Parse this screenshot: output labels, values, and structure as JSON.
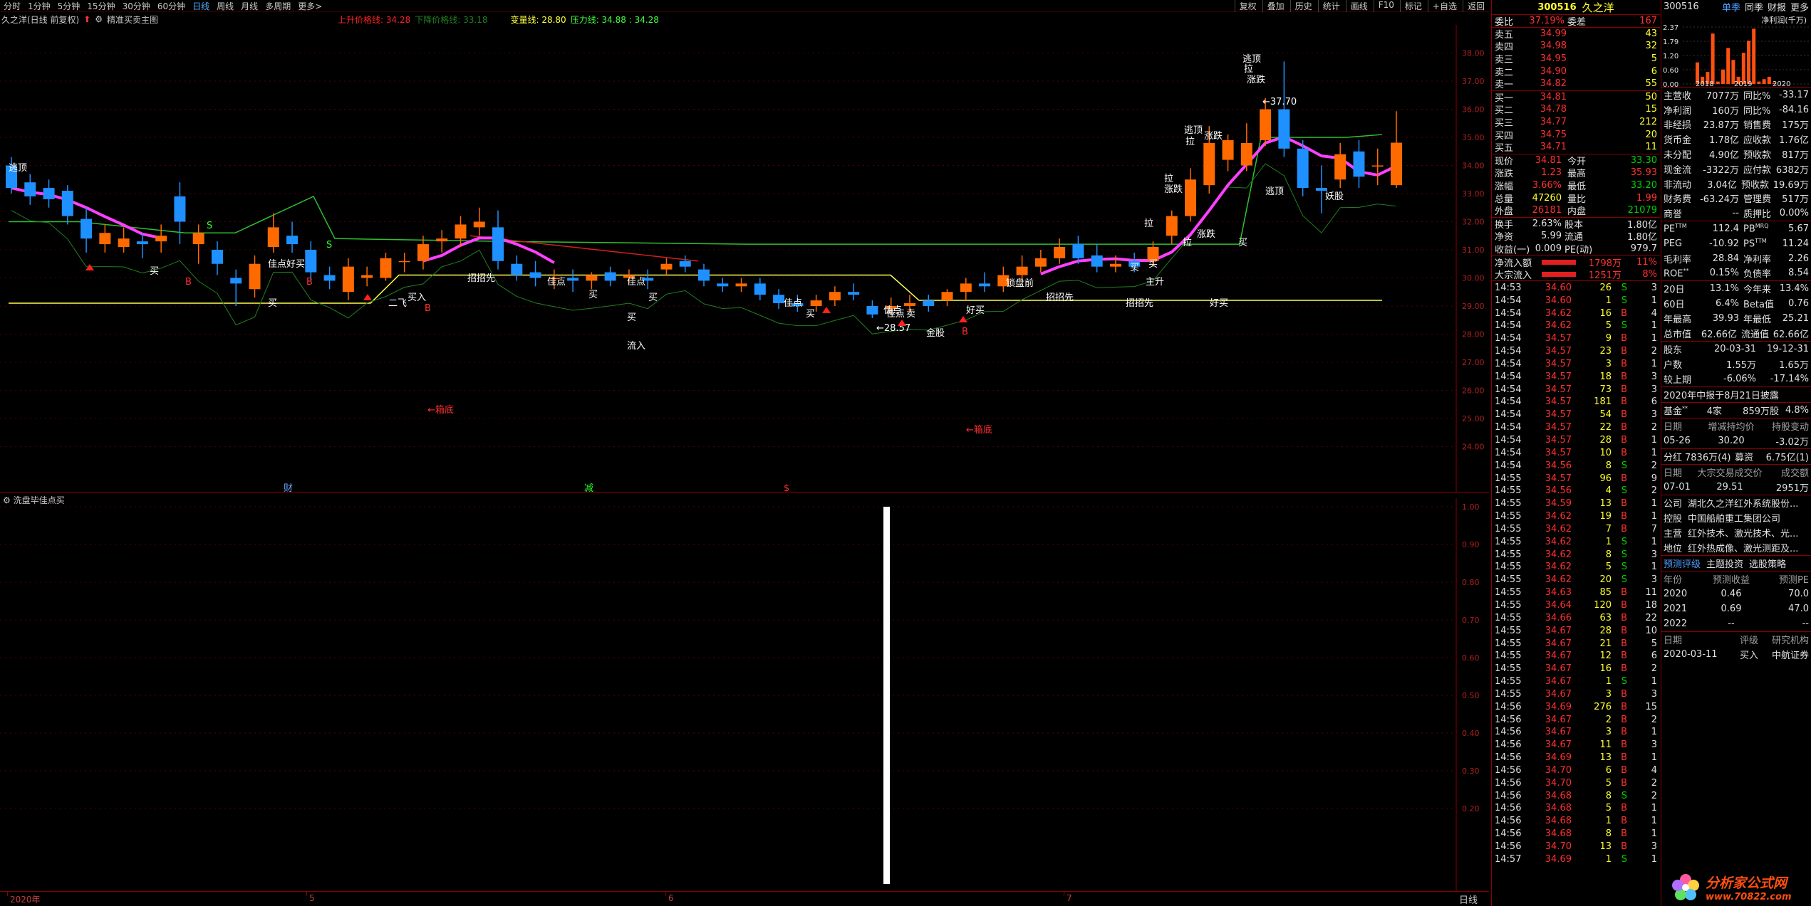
{
  "toolbar": {
    "periods": [
      "分时",
      "1分钟",
      "5分钟",
      "15分钟",
      "30分钟",
      "60分钟",
      "日线",
      "周线",
      "月线",
      "多周期",
      "更多>"
    ],
    "active_period": "日线",
    "right_buttons": [
      "复权",
      "叠加",
      "历史",
      "统计",
      "画线",
      "F10",
      "标记",
      "+自选",
      "返回"
    ]
  },
  "chart_info": {
    "stock_title": "久之洋(日线 前复权)",
    "formula_name": "精准买卖主图",
    "up_line_label": "上升价格线: 34.28",
    "down_line_label": "下降价格线: 33.18",
    "change_line_label": "变量线: 28.80",
    "pressure_line_label": "压力线: 34.88 : 34.28"
  },
  "price_axis": [
    "38.00",
    "37.00",
    "36.00",
    "35.00",
    "34.00",
    "33.00",
    "32.00",
    "31.00",
    "30.00",
    "29.00",
    "28.00",
    "27.00",
    "26.00",
    "25.00",
    "24.00"
  ],
  "sub_axis": [
    "1.00",
    "0.90",
    "0.80",
    "0.70",
    "0.60",
    "0.50",
    "0.40",
    "0.30",
    "0.20"
  ],
  "sub_panel": {
    "title": "洗盘毕佳点买"
  },
  "date_axis": {
    "labels": [
      "2020年",
      "5",
      "6",
      "7"
    ],
    "period": "日线"
  },
  "annotations": {
    "chart_texts": [
      "逃顶",
      "买",
      "B",
      "S",
      "佳点",
      "好买",
      "买",
      "B",
      "S",
      "二飞",
      "买入",
      "B",
      "招招先",
      "佳点",
      "买",
      "买",
      "流入",
      "佳点",
      "买",
      "佳点",
      "买",
      "佳点",
      "卖",
      "金股",
      "B",
      "←28.57",
      "佳点",
      "←箱底",
      "←箱底",
      "财",
      "减",
      "$",
      "锁盘前",
      "招招先",
      "好买",
      "招招先",
      "拉",
      "涨跌",
      "拉",
      "涨跌",
      "逃顶",
      "拉",
      "涨跌",
      "逃顶",
      "拉",
      "涨跌",
      "←37.70",
      "逃顶",
      "妖股",
      "买",
      "买",
      "拉",
      "主升",
      "好买",
      "买"
    ],
    "peak_label": "←37.70",
    "low_label": "←28.57"
  },
  "quote": {
    "code": "300516",
    "name": "久之洋",
    "weibi_label": "委比",
    "weibi_value": "37.19%",
    "weicha_label": "委差",
    "weicha_value": "167",
    "asks": [
      {
        "label": "卖五",
        "price": "34.99",
        "vol": "43"
      },
      {
        "label": "卖四",
        "price": "34.98",
        "vol": "32"
      },
      {
        "label": "卖三",
        "price": "34.95",
        "vol": "5"
      },
      {
        "label": "卖二",
        "price": "34.90",
        "vol": "6"
      },
      {
        "label": "卖一",
        "price": "34.82",
        "vol": "55"
      }
    ],
    "bids": [
      {
        "label": "买一",
        "price": "34.81",
        "vol": "50"
      },
      {
        "label": "买二",
        "price": "34.78",
        "vol": "15"
      },
      {
        "label": "买三",
        "price": "34.77",
        "vol": "212"
      },
      {
        "label": "买四",
        "price": "34.75",
        "vol": "20"
      },
      {
        "label": "买五",
        "price": "34.71",
        "vol": "11"
      }
    ],
    "stats": [
      {
        "l1": "现价",
        "v1": "34.81",
        "c1": "red",
        "l2": "今开",
        "v2": "33.30",
        "c2": "green"
      },
      {
        "l1": "涨跌",
        "v1": "1.23",
        "c1": "red",
        "l2": "最高",
        "v2": "35.93",
        "c2": "red"
      },
      {
        "l1": "涨幅",
        "v1": "3.66%",
        "c1": "red",
        "l2": "最低",
        "v2": "33.20",
        "c2": "green"
      },
      {
        "l1": "总量",
        "v1": "47260",
        "c1": "yellow",
        "l2": "量比",
        "v2": "1.99",
        "c2": "red"
      },
      {
        "l1": "外盘",
        "v1": "26181",
        "c1": "red",
        "l2": "内盘",
        "v2": "21079",
        "c2": "green"
      }
    ],
    "stats2": [
      {
        "l1": "换手",
        "v1": "2.63%",
        "l2": "股本",
        "v2": "1.80亿"
      },
      {
        "l1": "净资",
        "v1": "5.99",
        "l2": "流通",
        "v2": "1.80亿"
      },
      {
        "l1": "收益(一)",
        "v1": "0.009",
        "l2": "PE(动)",
        "v2": "979.7"
      }
    ],
    "flows": [
      {
        "label": "净流入额",
        "value": "1798万",
        "pct": "11%"
      },
      {
        "label": "大宗流入",
        "value": "1251万",
        "pct": "8%"
      }
    ],
    "ticks": [
      {
        "t": "14:53",
        "p": "34.60",
        "v": "26",
        "d": "S",
        "n": "3"
      },
      {
        "t": "14:54",
        "p": "34.60",
        "v": "1",
        "d": "S",
        "n": "1"
      },
      {
        "t": "14:54",
        "p": "34.62",
        "v": "16",
        "d": "B",
        "n": "4"
      },
      {
        "t": "14:54",
        "p": "34.62",
        "v": "5",
        "d": "S",
        "n": "1"
      },
      {
        "t": "14:54",
        "p": "34.57",
        "v": "9",
        "d": "B",
        "n": "1"
      },
      {
        "t": "14:54",
        "p": "34.57",
        "v": "23",
        "d": "B",
        "n": "2"
      },
      {
        "t": "14:54",
        "p": "34.57",
        "v": "3",
        "d": "B",
        "n": "1"
      },
      {
        "t": "14:54",
        "p": "34.57",
        "v": "18",
        "d": "B",
        "n": "3"
      },
      {
        "t": "14:54",
        "p": "34.57",
        "v": "73",
        "d": "B",
        "n": "3"
      },
      {
        "t": "14:54",
        "p": "34.57",
        "v": "181",
        "d": "B",
        "n": "6"
      },
      {
        "t": "14:54",
        "p": "34.57",
        "v": "54",
        "d": "B",
        "n": "3"
      },
      {
        "t": "14:54",
        "p": "34.57",
        "v": "22",
        "d": "B",
        "n": "2"
      },
      {
        "t": "14:54",
        "p": "34.57",
        "v": "28",
        "d": "B",
        "n": "1"
      },
      {
        "t": "14:54",
        "p": "34.57",
        "v": "10",
        "d": "B",
        "n": "1"
      },
      {
        "t": "14:54",
        "p": "34.56",
        "v": "8",
        "d": "S",
        "n": "2"
      },
      {
        "t": "14:55",
        "p": "34.57",
        "v": "96",
        "d": "B",
        "n": "9"
      },
      {
        "t": "14:55",
        "p": "34.56",
        "v": "4",
        "d": "S",
        "n": "2"
      },
      {
        "t": "14:55",
        "p": "34.59",
        "v": "13",
        "d": "B",
        "n": "1"
      },
      {
        "t": "14:55",
        "p": "34.62",
        "v": "19",
        "d": "B",
        "n": "1"
      },
      {
        "t": "14:55",
        "p": "34.62",
        "v": "7",
        "d": "B",
        "n": "7"
      },
      {
        "t": "14:55",
        "p": "34.62",
        "v": "1",
        "d": "S",
        "n": "1"
      },
      {
        "t": "14:55",
        "p": "34.62",
        "v": "8",
        "d": "S",
        "n": "3"
      },
      {
        "t": "14:55",
        "p": "34.62",
        "v": "5",
        "d": "S",
        "n": "1"
      },
      {
        "t": "14:55",
        "p": "34.62",
        "v": "20",
        "d": "S",
        "n": "3"
      },
      {
        "t": "14:55",
        "p": "34.63",
        "v": "85",
        "d": "B",
        "n": "11"
      },
      {
        "t": "14:55",
        "p": "34.64",
        "v": "120",
        "d": "B",
        "n": "18"
      },
      {
        "t": "14:55",
        "p": "34.66",
        "v": "63",
        "d": "B",
        "n": "22"
      },
      {
        "t": "14:55",
        "p": "34.67",
        "v": "28",
        "d": "B",
        "n": "10"
      },
      {
        "t": "14:55",
        "p": "34.67",
        "v": "21",
        "d": "B",
        "n": "5"
      },
      {
        "t": "14:55",
        "p": "34.67",
        "v": "12",
        "d": "B",
        "n": "6"
      },
      {
        "t": "14:55",
        "p": "34.67",
        "v": "16",
        "d": "B",
        "n": "2"
      },
      {
        "t": "14:55",
        "p": "34.67",
        "v": "1",
        "d": "S",
        "n": "1"
      },
      {
        "t": "14:55",
        "p": "34.67",
        "v": "3",
        "d": "B",
        "n": "3"
      },
      {
        "t": "14:56",
        "p": "34.69",
        "v": "276",
        "d": "B",
        "n": "15"
      },
      {
        "t": "14:56",
        "p": "34.67",
        "v": "2",
        "d": "B",
        "n": "2"
      },
      {
        "t": "14:56",
        "p": "34.67",
        "v": "3",
        "d": "B",
        "n": "1"
      },
      {
        "t": "14:56",
        "p": "34.67",
        "v": "11",
        "d": "B",
        "n": "3"
      },
      {
        "t": "14:56",
        "p": "34.69",
        "v": "13",
        "d": "B",
        "n": "1"
      },
      {
        "t": "14:56",
        "p": "34.70",
        "v": "6",
        "d": "B",
        "n": "4"
      },
      {
        "t": "14:56",
        "p": "34.70",
        "v": "5",
        "d": "B",
        "n": "2"
      },
      {
        "t": "14:56",
        "p": "34.68",
        "v": "8",
        "d": "S",
        "n": "2"
      },
      {
        "t": "14:56",
        "p": "34.68",
        "v": "5",
        "d": "B",
        "n": "1"
      },
      {
        "t": "14:56",
        "p": "34.68",
        "v": "1",
        "d": "B",
        "n": "1"
      },
      {
        "t": "14:56",
        "p": "34.68",
        "v": "8",
        "d": "B",
        "n": "1"
      },
      {
        "t": "14:56",
        "p": "34.70",
        "v": "13",
        "d": "B",
        "n": "3"
      },
      {
        "t": "14:57",
        "p": "34.69",
        "v": "1",
        "d": "S",
        "n": "1"
      }
    ]
  },
  "f10": {
    "code": "300516",
    "tabs": [
      "单季",
      "同季",
      "财报",
      "更多"
    ],
    "chart_title": "净利润(千万)",
    "chart_years": [
      "2018",
      "2019",
      "2020"
    ],
    "chart_yticks": [
      "2.37",
      "1.79",
      "1.20",
      "0.60",
      "0.00"
    ],
    "chart_bars": [
      0.9,
      0.3,
      0.5,
      2.1,
      0.1,
      0.6,
      1.5,
      1.0,
      0.3,
      1.3,
      1.8,
      2.3,
      0.1,
      0.2,
      0.3,
      0.05
    ],
    "finance": [
      {
        "l1": "主营收",
        "v1": "7077万",
        "l2": "同比%",
        "v2": "-33.17"
      },
      {
        "l1": "净利润",
        "v1": "160万",
        "l2": "同比%",
        "v2": "-84.16"
      },
      {
        "l1": "非经损",
        "v1": "23.87万",
        "l2": "销售费",
        "v2": "175万"
      },
      {
        "l1": "货币金",
        "v1": "1.78亿",
        "l2": "应收款",
        "v2": "1.76亿"
      },
      {
        "l1": "未分配",
        "v1": "4.90亿",
        "l2": "预收款",
        "v2": "817万"
      },
      {
        "l1": "现金流",
        "v1": "-3322万",
        "l2": "应付款",
        "v2": "6382万"
      },
      {
        "l1": "非流动",
        "v1": "3.04亿",
        "l2": "预收款",
        "v2": "19.69万"
      },
      {
        "l1": "财务费",
        "v1": "-63.24万",
        "l2": "管理费",
        "v2": "517万"
      },
      {
        "l1": "商誉",
        "v1": "--",
        "l2": "质押比",
        "v2": "0.00%"
      }
    ],
    "valuation": [
      {
        "l1": "PE",
        "s1": "TTM",
        "v1": "112.4",
        "l2": "PB",
        "s2": "MRQ",
        "v2": "5.67"
      },
      {
        "l1": "PEG",
        "s1": "",
        "v1": "-10.92",
        "l2": "PS",
        "s2": "TTM",
        "v2": "11.24"
      },
      {
        "l1": "毛利率",
        "s1": "",
        "v1": "28.84",
        "l2": "净利率",
        "s2": "",
        "v2": "2.26"
      },
      {
        "l1": "ROE",
        "s1": "**",
        "v1": "0.15%",
        "l2": "负债率",
        "s2": "",
        "v2": "8.54"
      }
    ],
    "perf": [
      {
        "l1": "20日",
        "v1": "13.1%",
        "l2": "今年来",
        "v2": "13.4%"
      },
      {
        "l1": "60日",
        "v1": "6.4%",
        "l2": "Beta值",
        "v2": "0.76"
      },
      {
        "l1": "年最高",
        "v1": "39.93",
        "l2": "年最低",
        "v2": "25.21"
      },
      {
        "l1": "总市值",
        "v1": "62.66亿",
        "l2": "流通值",
        "v2": "62.66亿"
      }
    ],
    "holders": [
      {
        "l1": "股东",
        "v1": "20-03-31",
        "v2": "19-12-31"
      },
      {
        "l1": "户数",
        "v1": "1.55万",
        "v2": "1.65万"
      },
      {
        "l1": "较上期",
        "v1": "-6.06%",
        "v2": "-17.14%"
      }
    ],
    "report_notice": "2020年中报于8月21日披露",
    "fund": {
      "l1": "基金",
      "s1": "**",
      "v1": "4家",
      "v2": "859万股",
      "v3": "4.8%"
    },
    "change_head": [
      "日期",
      "增减持均价",
      "持股变动"
    ],
    "change_row": [
      "05-26",
      "30.20",
      "-3.02万"
    ],
    "dividend": {
      "l1": "分红",
      "v1": "7836万(4)",
      "l2": "募资",
      "v2": "6.75亿(1)"
    },
    "block_head": [
      "日期",
      "大宗交易成交价",
      "成交额"
    ],
    "block_row": [
      "07-01",
      "29.51",
      "2951万"
    ],
    "company": [
      {
        "l": "公司",
        "v": "湖北久之洋红外系统股份..."
      },
      {
        "l": "控股",
        "v": "中国船舶重工集团公司"
      },
      {
        "l": "主营",
        "v": "红外技术、激光技术、光..."
      },
      {
        "l": "地位",
        "v": "红外热成像、激光测距及..."
      }
    ],
    "links": [
      "预测评级",
      "主题投资",
      "选股策略"
    ],
    "forecast_head": [
      "年份",
      "预测收益",
      "预测PE"
    ],
    "forecast": [
      [
        "2020",
        "0.46",
        "70.0"
      ],
      [
        "2021",
        "0.69",
        "47.0"
      ],
      [
        "2022",
        "--",
        "--"
      ]
    ],
    "rating_head": [
      "日期",
      "评级",
      "研究机构"
    ],
    "rating": [
      [
        "2020-03-11",
        "买入",
        "中航证券"
      ]
    ],
    "watermark_cn": "分析家公式网",
    "watermark_url": "www.70822.com"
  },
  "colors": {
    "up": "#ff6a00",
    "down": "#1e90ff",
    "ma_pink": "#ff40ff",
    "line_yellow": "#ffff50",
    "line_green": "#30c030",
    "line_red": "#d02020",
    "grid": "#550000"
  },
  "candles": [
    {
      "o": 34.0,
      "c": 33.2,
      "h": 34.3,
      "l": 33.0
    },
    {
      "o": 33.4,
      "c": 32.9,
      "h": 33.7,
      "l": 32.6
    },
    {
      "o": 33.2,
      "c": 32.8,
      "h": 33.5,
      "l": 32.5
    },
    {
      "o": 33.1,
      "c": 32.2,
      "h": 33.3,
      "l": 31.9
    },
    {
      "o": 32.1,
      "c": 31.4,
      "h": 32.5,
      "l": 30.9
    },
    {
      "o": 31.2,
      "c": 31.6,
      "h": 31.9,
      "l": 30.9
    },
    {
      "o": 31.1,
      "c": 31.4,
      "h": 31.8,
      "l": 30.9
    },
    {
      "o": 31.3,
      "c": 31.2,
      "h": 31.6,
      "l": 30.7
    },
    {
      "o": 31.3,
      "c": 31.5,
      "h": 31.9,
      "l": 30.9
    },
    {
      "o": 32.9,
      "c": 32.0,
      "h": 33.4,
      "l": 31.2
    },
    {
      "o": 31.2,
      "c": 31.6,
      "h": 31.9,
      "l": 30.5
    },
    {
      "o": 31.0,
      "c": 30.5,
      "h": 31.3,
      "l": 30.1
    },
    {
      "o": 30.0,
      "c": 29.8,
      "h": 30.3,
      "l": 29.0
    },
    {
      "o": 29.6,
      "c": 30.5,
      "h": 30.8,
      "l": 29.3
    },
    {
      "o": 31.1,
      "c": 31.8,
      "h": 32.3,
      "l": 30.9
    },
    {
      "o": 31.5,
      "c": 31.2,
      "h": 32.0,
      "l": 30.9
    },
    {
      "o": 31.0,
      "c": 30.2,
      "h": 31.3,
      "l": 29.9
    },
    {
      "o": 30.1,
      "c": 29.9,
      "h": 30.4,
      "l": 29.6
    },
    {
      "o": 29.5,
      "c": 30.4,
      "h": 30.7,
      "l": 29.2
    },
    {
      "o": 30.0,
      "c": 30.1,
      "h": 30.4,
      "l": 29.7
    },
    {
      "o": 30.0,
      "c": 30.7,
      "h": 30.9,
      "l": 29.9
    },
    {
      "o": 30.6,
      "c": 30.6,
      "h": 30.9,
      "l": 30.2
    },
    {
      "o": 30.6,
      "c": 31.2,
      "h": 31.5,
      "l": 30.3
    },
    {
      "o": 31.3,
      "c": 31.4,
      "h": 31.7,
      "l": 30.9
    },
    {
      "o": 31.4,
      "c": 31.9,
      "h": 32.2,
      "l": 31.1
    },
    {
      "o": 31.8,
      "c": 32.0,
      "h": 32.5,
      "l": 31.5
    },
    {
      "o": 31.8,
      "c": 30.6,
      "h": 32.4,
      "l": 30.3
    },
    {
      "o": 30.5,
      "c": 30.1,
      "h": 30.8,
      "l": 29.9
    },
    {
      "o": 30.2,
      "c": 30.0,
      "h": 30.6,
      "l": 29.7
    },
    {
      "o": 30.0,
      "c": 30.0,
      "h": 30.3,
      "l": 29.6
    },
    {
      "o": 30.0,
      "c": 29.9,
      "h": 30.3,
      "l": 29.5
    },
    {
      "o": 29.9,
      "c": 30.1,
      "h": 30.2,
      "l": 29.6
    },
    {
      "o": 30.2,
      "c": 29.9,
      "h": 30.4,
      "l": 29.7
    },
    {
      "o": 30.0,
      "c": 30.1,
      "h": 30.3,
      "l": 29.8
    },
    {
      "o": 30.0,
      "c": 29.9,
      "h": 30.3,
      "l": 29.6
    },
    {
      "o": 30.3,
      "c": 30.5,
      "h": 30.7,
      "l": 30.1
    },
    {
      "o": 30.6,
      "c": 30.4,
      "h": 30.8,
      "l": 30.2
    },
    {
      "o": 30.3,
      "c": 29.9,
      "h": 30.5,
      "l": 29.7
    },
    {
      "o": 29.8,
      "c": 29.7,
      "h": 30.0,
      "l": 29.5
    },
    {
      "o": 29.7,
      "c": 29.8,
      "h": 30.0,
      "l": 29.5
    },
    {
      "o": 29.8,
      "c": 29.4,
      "h": 30.0,
      "l": 29.2
    },
    {
      "o": 29.4,
      "c": 29.1,
      "h": 29.6,
      "l": 28.9
    },
    {
      "o": 29.1,
      "c": 29.0,
      "h": 29.4,
      "l": 28.8
    },
    {
      "o": 29.0,
      "c": 29.2,
      "h": 29.4,
      "l": 28.8
    },
    {
      "o": 29.2,
      "c": 29.5,
      "h": 29.7,
      "l": 29.0
    },
    {
      "o": 29.5,
      "c": 29.4,
      "h": 29.8,
      "l": 29.2
    },
    {
      "o": 29.0,
      "c": 28.7,
      "h": 29.2,
      "l": 28.57
    },
    {
      "o": 28.9,
      "c": 29.0,
      "h": 29.3,
      "l": 28.7
    },
    {
      "o": 29.0,
      "c": 29.1,
      "h": 29.4,
      "l": 28.8
    },
    {
      "o": 29.2,
      "c": 29.0,
      "h": 29.4,
      "l": 28.8
    },
    {
      "o": 29.2,
      "c": 29.5,
      "h": 29.6,
      "l": 29.0
    },
    {
      "o": 29.5,
      "c": 29.8,
      "h": 30.0,
      "l": 29.2
    },
    {
      "o": 29.8,
      "c": 29.7,
      "h": 30.2,
      "l": 29.5
    },
    {
      "o": 29.7,
      "c": 30.1,
      "h": 30.4,
      "l": 29.5
    },
    {
      "o": 30.1,
      "c": 30.4,
      "h": 30.8,
      "l": 29.9
    },
    {
      "o": 30.4,
      "c": 30.7,
      "h": 31.0,
      "l": 30.2
    },
    {
      "o": 30.7,
      "c": 31.1,
      "h": 31.4,
      "l": 30.5
    },
    {
      "o": 31.2,
      "c": 30.7,
      "h": 31.5,
      "l": 30.5
    },
    {
      "o": 30.8,
      "c": 30.4,
      "h": 31.2,
      "l": 30.2
    },
    {
      "o": 30.4,
      "c": 30.5,
      "h": 30.8,
      "l": 30.2
    },
    {
      "o": 30.6,
      "c": 30.4,
      "h": 30.9,
      "l": 30.2
    },
    {
      "o": 30.6,
      "c": 31.1,
      "h": 31.3,
      "l": 30.4
    },
    {
      "o": 31.5,
      "c": 32.2,
      "h": 32.4,
      "l": 31.2
    },
    {
      "o": 32.2,
      "c": 33.5,
      "h": 33.9,
      "l": 32.0
    },
    {
      "o": 33.3,
      "c": 34.8,
      "h": 35.4,
      "l": 33.0
    },
    {
      "o": 34.2,
      "c": 34.9,
      "h": 35.1,
      "l": 33.8
    },
    {
      "o": 34.0,
      "c": 34.8,
      "h": 35.5,
      "l": 33.8
    },
    {
      "o": 34.9,
      "c": 36.0,
      "h": 36.4,
      "l": 34.7
    },
    {
      "o": 36.0,
      "c": 34.6,
      "h": 37.7,
      "l": 34.3
    },
    {
      "o": 34.6,
      "c": 33.2,
      "h": 34.9,
      "l": 32.9
    },
    {
      "o": 33.2,
      "c": 33.1,
      "h": 34.0,
      "l": 32.3
    },
    {
      "o": 33.5,
      "c": 34.4,
      "h": 34.8,
      "l": 33.2
    },
    {
      "o": 34.5,
      "c": 33.6,
      "h": 34.9,
      "l": 33.2
    },
    {
      "o": 34.0,
      "c": 34.0,
      "h": 34.6,
      "l": 33.3
    },
    {
      "o": 33.3,
      "c": 34.81,
      "h": 35.93,
      "l": 33.2
    }
  ],
  "sub_bar_value": 1.0
}
